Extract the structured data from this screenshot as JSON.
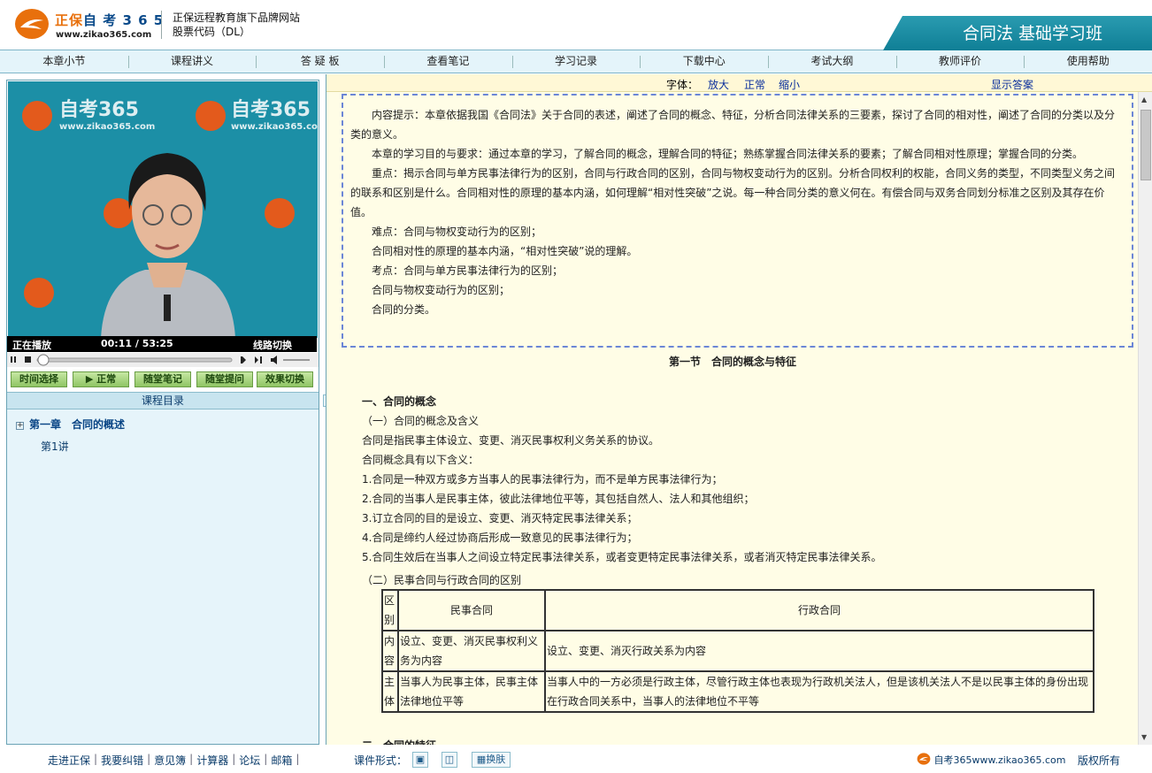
{
  "header": {
    "brand_a": "正保",
    "brand_b": "自 考 3 6 5",
    "url": "www.zikao365.com",
    "tagline_1": "正保远程教育旗下品牌网站",
    "tagline_2": "股票代码（DL）",
    "course_title": "合同法 基础学习班"
  },
  "nav": [
    "本章小节",
    "课程讲义",
    "答 疑 板",
    "查看笔记",
    "学习记录",
    "下载中心",
    "考试大纲",
    "教师评价",
    "使用帮助"
  ],
  "video": {
    "watermark_title": "自考365",
    "watermark_url": "www.zikao365.com",
    "status": "正在播放",
    "time": "00:11  /  53:25",
    "line": "线路切换"
  },
  "play_buttons": [
    "时间选择",
    "▶ 正常",
    "随堂笔记",
    "随堂提问",
    "效果切换"
  ],
  "catalog": {
    "title": "课程目录",
    "plus": "+",
    "chapter": "第一章　合同的概述",
    "lecture": "第1讲"
  },
  "fontbar": {
    "label": "字体：",
    "bigger": "放大",
    "normal": "正常",
    "smaller": "缩小",
    "answer": "显示答案"
  },
  "intro": [
    "　　内容提示：本章依据我国《合同法》关于合同的表述，阐述了合同的概念、特征，分析合同法律关系的三要素，探讨了合同的相对性，阐述了合同的分类以及分类的意义。",
    "　　本章的学习目的与要求：通过本章的学习，了解合同的概念，理解合同的特征；熟练掌握合同法律关系的要素；了解合同相对性原理；掌握合同的分类。",
    "　　重点：揭示合同与单方民事法律行为的区别，合同与行政合同的区别，合同与物权变动行为的区别。分析合同权利的权能，合同义务的类型，不同类型义务之间的联系和区别是什么。合同相对性的原理的基本内涵，如何理解“相对性突破”之说。每一种合同分类的意义何在。有偿合同与双务合同划分标准之区别及其存在价值。",
    "　　难点：合同与物权变动行为的区别；",
    "　　合同相对性的原理的基本内涵，“相对性突破”说的理解。",
    "　　考点：合同与单方民事法律行为的区别；",
    "　　合同与物权变动行为的区别；",
    "　　合同的分类。"
  ],
  "section_title": "第一节　合同的概念与特征",
  "body": {
    "h1": "一、合同的概念",
    "h1_sub": "（一）合同的概念及含义",
    "def": "合同是指民事主体设立、变更、消灭民事权利义务关系的协议。",
    "meaning": "合同概念具有以下含义：",
    "points": [
      "1.合同是一种双方或多方当事人的民事法律行为，而不是单方民事法律行为；",
      "2.合同的当事人是民事主体，彼此法律地位平等，其包括自然人、法人和其他组织；",
      "3.订立合同的目的是设立、变更、消灭特定民事法律关系；",
      "4.合同是缔约人经过协商后形成一致意见的民事法律行为；",
      "5.合同生效后在当事人之间设立特定民事法律关系，或者变更特定民事法律关系，或者消灭特定民事法律关系。"
    ],
    "h2_sub": "（二）民事合同与行政合同的区别",
    "h3": "二、合同的特征"
  },
  "table": {
    "head": [
      "区别",
      "民事合同",
      "行政合同"
    ],
    "rows": [
      [
        "内容",
        "设立、变更、消灭民事权利义务为内容",
        "设立、变更、消灭行政关系为内容"
      ],
      [
        "主体",
        "当事人为民事主体，民事主体法律地位平等",
        "当事人中的一方必须是行政主体，尽管行政主体也表现为行政机关法人，但是该机关法人不是以民事主体的身份出现在行政合同关系中，当事人的法律地位不平等"
      ]
    ]
  },
  "footer": {
    "links": [
      "走进正保",
      "我要纠错",
      "意见簿",
      "计算器",
      "论坛",
      "邮箱"
    ],
    "sep": "|",
    "form_label": "课件形式：",
    "skin": "换肤",
    "site": "自考365www.zikao365.com",
    "copyright": "版权所有"
  }
}
